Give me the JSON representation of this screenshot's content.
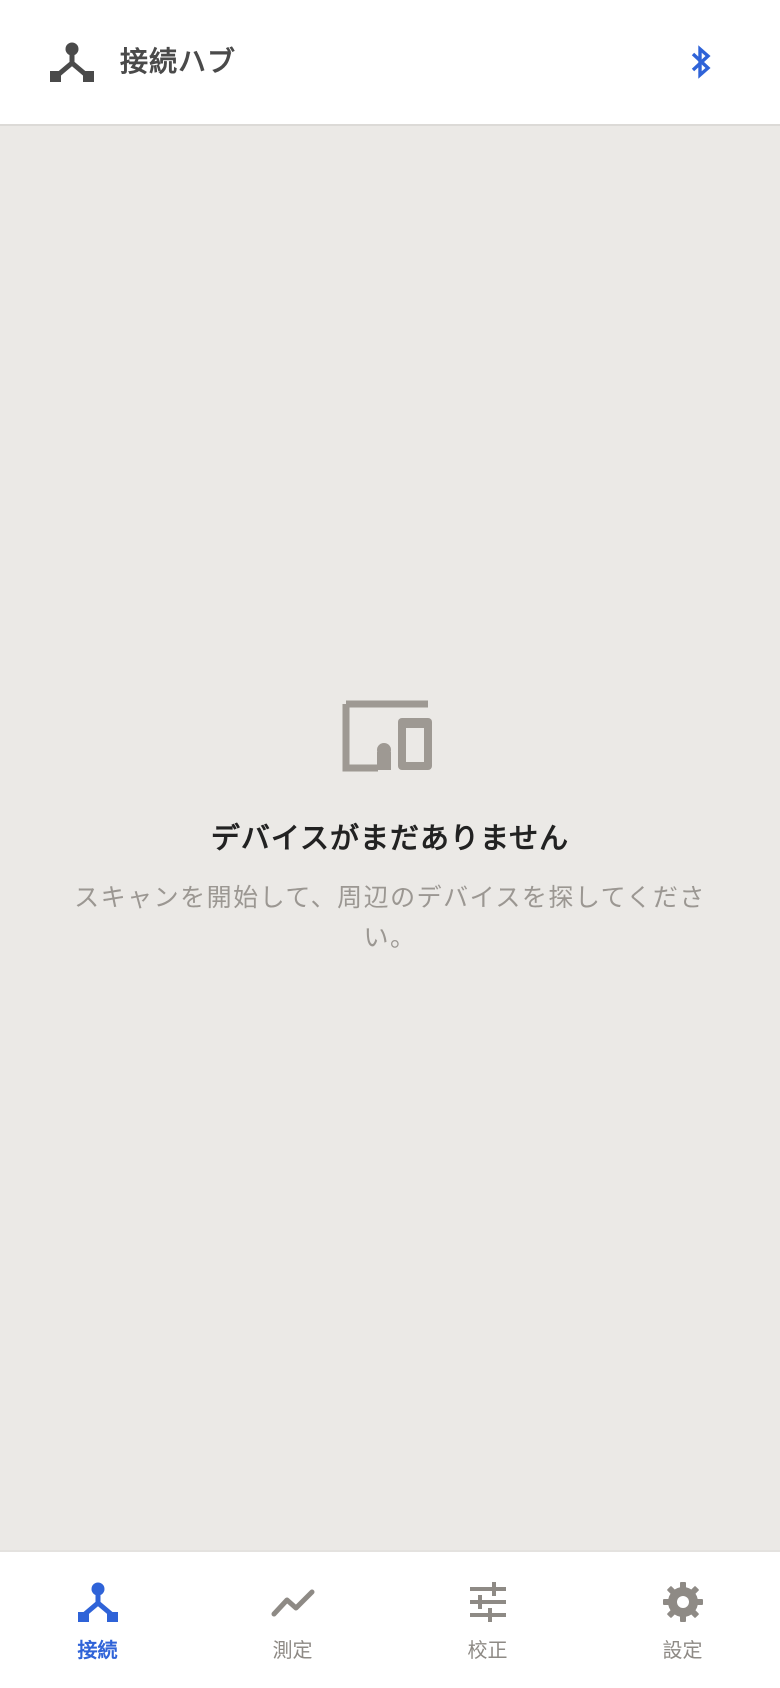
{
  "colors": {
    "accent": "#2f63d8",
    "background": "#ebe9e6",
    "header_bg": "#ffffff",
    "icon_gray": "#9e9993",
    "title_dark": "#4a4a4a"
  },
  "header": {
    "title": "接続ハブ",
    "logo_icon": "hub-icon",
    "action_icon": "bluetooth-icon"
  },
  "empty_state": {
    "icon": "devices-icon",
    "title": "デバイスがまだありません",
    "description": "スキャンを開始して、周辺のデバイスを探してください。"
  },
  "tabs": [
    {
      "label": "接続",
      "icon": "hub-icon",
      "active": true
    },
    {
      "label": "測定",
      "icon": "trend-icon",
      "active": false
    },
    {
      "label": "校正",
      "icon": "tune-icon",
      "active": false
    },
    {
      "label": "設定",
      "icon": "gear-icon",
      "active": false
    }
  ]
}
